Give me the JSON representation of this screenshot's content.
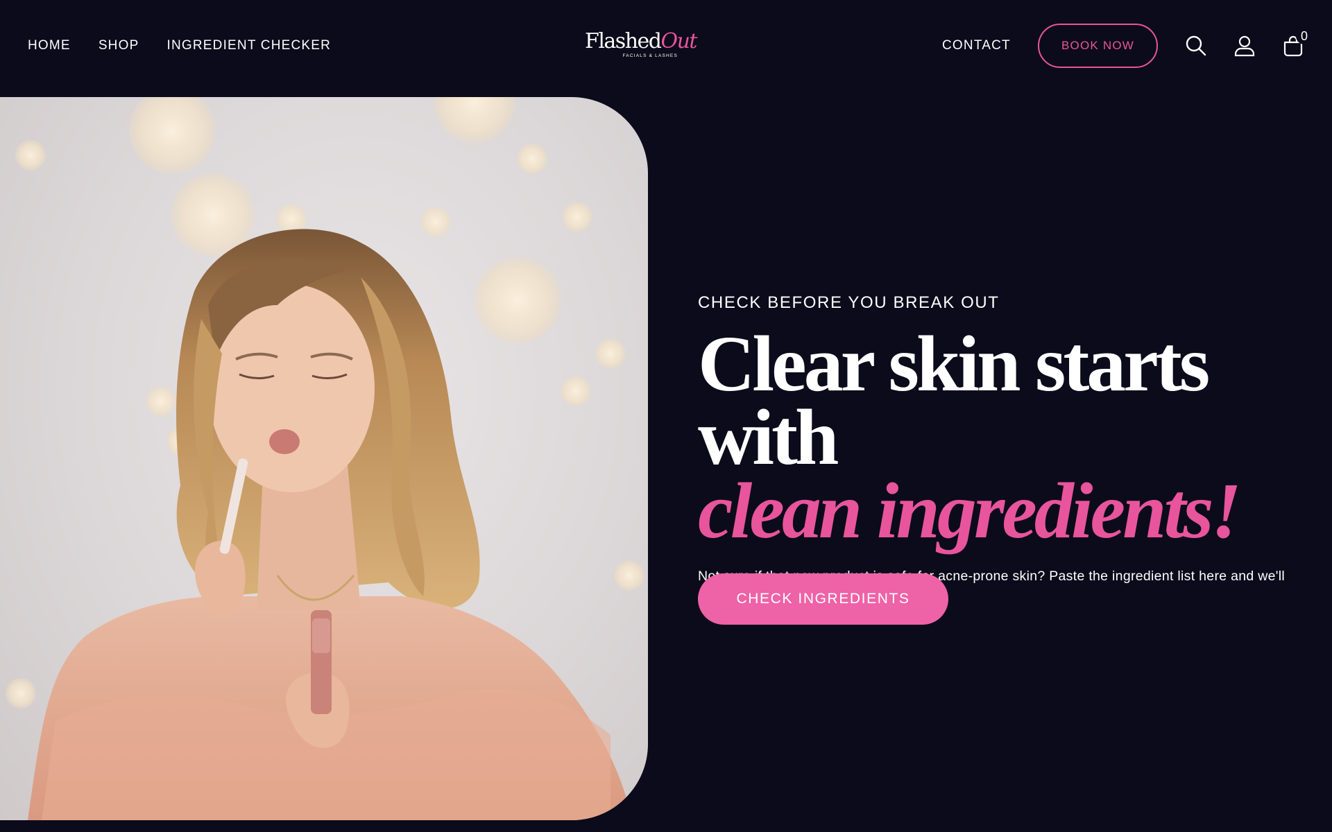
{
  "nav": {
    "left": [
      "HOME",
      "SHOP",
      "INGREDIENT CHECKER"
    ],
    "contact": "CONTACT",
    "book_now": "BOOK NOW",
    "cart_count": "0"
  },
  "logo": {
    "word1": "Flashed",
    "word2": "Out",
    "tagline": "FACIALS & LASHES"
  },
  "hero": {
    "eyebrow": "CHECK BEFORE YOU BREAK OUT",
    "headline_line1": "Clear skin starts with",
    "headline_line2": "clean ingredients!",
    "body": "Not sure if that new product is safe for acne-prone skin? Paste the ingredient list here and we'll flag anything that might clog your pores.",
    "cta": "CHECK INGREDIENTS"
  },
  "icons": [
    "search-icon",
    "account-icon",
    "cart-icon"
  ],
  "colors": {
    "background": "#0c0b1b",
    "accent_pink": "#e8559c",
    "cta_pink": "#ee62a7",
    "text": "#ffffff"
  }
}
